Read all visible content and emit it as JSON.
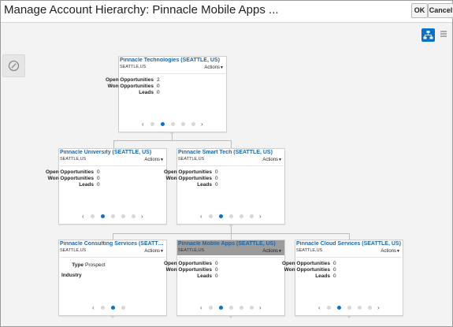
{
  "header": {
    "title": "Manage Account Hierarchy: Pinnacle Mobile Apps ...",
    "ok_label": "OK",
    "cancel_label": "Cancel"
  },
  "toolbar": {
    "hierarchy_view_icon": "org-chart-icon",
    "list_view_icon": "list-icon",
    "nav_icon": "compass-icon",
    "accent_color": "#0a70c9"
  },
  "cards": [
    {
      "name": "Pinnacle Technologies (SEATTLE, US)",
      "location": "SEATTLE,US",
      "actions": "Actions",
      "selected": false,
      "metrics": [
        {
          "label": "Open Opportunities",
          "value": "2"
        },
        {
          "label": "Won Opportunities",
          "value": "0"
        },
        {
          "label": "Leads",
          "value": "0"
        }
      ]
    },
    {
      "name": "Pinnacle University (SEATTLE, US)",
      "location": "SEATTLE,US",
      "actions": "Actions",
      "selected": false,
      "metrics": [
        {
          "label": "Open Opportunities",
          "value": "0"
        },
        {
          "label": "Won Opportunities",
          "value": "0"
        },
        {
          "label": "Leads",
          "value": "0"
        }
      ]
    },
    {
      "name": "Pinnacle Smart Tech (SEATTLE, US)",
      "location": "SEATTLE,US",
      "actions": "Actions",
      "selected": false,
      "metrics": [
        {
          "label": "Open Opportunities",
          "value": "0"
        },
        {
          "label": "Won Opportunities",
          "value": "0"
        },
        {
          "label": "Leads",
          "value": "0"
        }
      ]
    },
    {
      "name": "Pinnacle Consulting Services (SEATTLE, US)",
      "location": "SEATTLE,US",
      "actions": "Actions",
      "selected": false,
      "fields": [
        {
          "label": "Type",
          "value": "Prospect"
        },
        {
          "label": "Industry",
          "value": ""
        }
      ]
    },
    {
      "name": "Pinnacle Mobile Apps (SEATTLE, US)",
      "location": "SEATTLE,US",
      "actions": "Actions",
      "selected": true,
      "metrics": [
        {
          "label": "Open Opportunities",
          "value": "0"
        },
        {
          "label": "Won Opportunities",
          "value": "0"
        },
        {
          "label": "Leads",
          "value": "0"
        }
      ]
    },
    {
      "name": "Pinnacle Cloud Services (SEATTLE, US)",
      "location": "SEATTLE,US",
      "actions": "Actions",
      "selected": false,
      "metrics": [
        {
          "label": "Open Opportunities",
          "value": "0"
        },
        {
          "label": "Won Opportunities",
          "value": "0"
        },
        {
          "label": "Leads",
          "value": "0"
        }
      ]
    }
  ],
  "pager": {
    "pages": 5
  }
}
